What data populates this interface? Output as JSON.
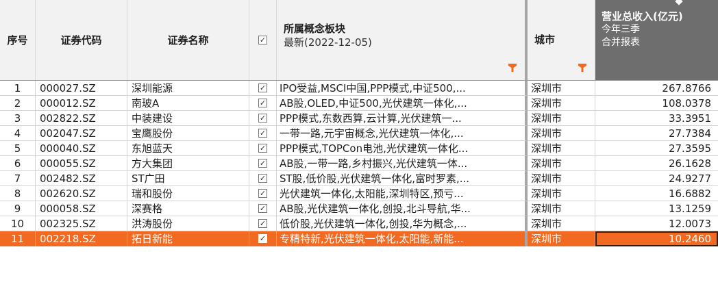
{
  "header": {
    "col_index": "序号",
    "col_code": "证券代码",
    "col_name": "证券名称",
    "col_concept_title": "所属概念板块",
    "col_concept_sub": "最新(2022-12-05)",
    "col_city": "城市",
    "col_revenue_title": "营业总收入(亿元)",
    "col_revenue_sub1": "今年三季",
    "col_revenue_sub2": "合并报表",
    "checkbox_mark": "✓"
  },
  "colors": {
    "header_bg": "#f2f2f2",
    "selected_row": "#f26a21",
    "filter_icon": "#f26a21",
    "revenue_header_bg": "#6e6e6e"
  },
  "rows": [
    {
      "idx": "1",
      "code": "000027.SZ",
      "name": "深圳能源",
      "concept": "IPO受益,MSCI中国,PPP模式,中证500,...",
      "city": "深圳市",
      "revenue": "267.8766"
    },
    {
      "idx": "2",
      "code": "000012.SZ",
      "name": "南玻A",
      "concept": "AB股,OLED,中证500,光伏建筑一体化,...",
      "city": "深圳市",
      "revenue": "108.0378"
    },
    {
      "idx": "3",
      "code": "002822.SZ",
      "name": "中装建设",
      "concept": "PPP模式,东数西算,云计算,光伏建筑一...",
      "city": "深圳市",
      "revenue": "33.3951"
    },
    {
      "idx": "4",
      "code": "002047.SZ",
      "name": "宝鹰股份",
      "concept": "一带一路,元宇宙概念,光伏建筑一体化,...",
      "city": "深圳市",
      "revenue": "27.7384"
    },
    {
      "idx": "5",
      "code": "000040.SZ",
      "name": "东旭蓝天",
      "concept": "PPP模式,TOPCon电池,光伏建筑一体化...",
      "city": "深圳市",
      "revenue": "27.3595"
    },
    {
      "idx": "6",
      "code": "000055.SZ",
      "name": "方大集团",
      "concept": "AB股,一带一路,乡村振兴,光伏建筑一体...",
      "city": "深圳市",
      "revenue": "26.1628"
    },
    {
      "idx": "7",
      "code": "002482.SZ",
      "name": "ST广田",
      "concept": "ST股,低价股,光伏建筑一体化,富时罗素,...",
      "city": "深圳市",
      "revenue": "24.9277"
    },
    {
      "idx": "8",
      "code": "002620.SZ",
      "name": "瑞和股份",
      "concept": "光伏建筑一体化,太阳能,深圳特区,预亏...",
      "city": "深圳市",
      "revenue": "16.6882"
    },
    {
      "idx": "9",
      "code": "000058.SZ",
      "name": "深赛格",
      "concept": "AB股,光伏建筑一体化,创投,北斗导航,华...",
      "city": "深圳市",
      "revenue": "13.1259"
    },
    {
      "idx": "10",
      "code": "002325.SZ",
      "name": "洪涛股份",
      "concept": "低价股,光伏建筑一体化,创投,华为概念,...",
      "city": "深圳市",
      "revenue": "12.0073"
    },
    {
      "idx": "11",
      "code": "002218.SZ",
      "name": "拓日新能",
      "concept": "专精特新,光伏建筑一体化,太阳能,新能...",
      "city": "深圳市",
      "revenue": "10.2460",
      "selected": true
    }
  ]
}
